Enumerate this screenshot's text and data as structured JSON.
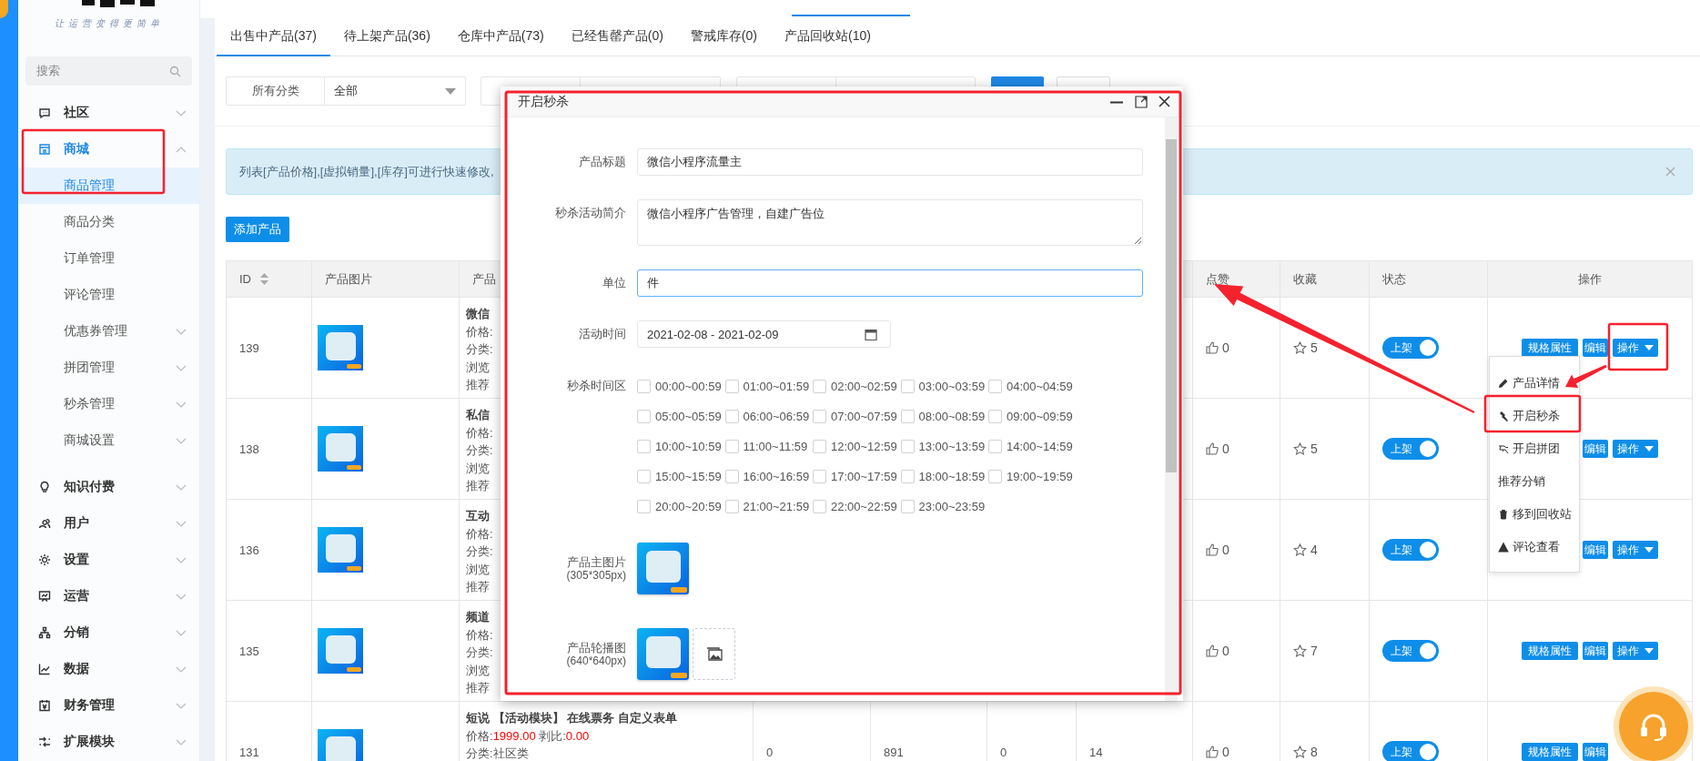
{
  "sidebar": {
    "slogan": "让运营变得更简单",
    "search": {
      "placeholder": "搜索"
    },
    "items": [
      {
        "label": "社区",
        "selected": false,
        "expanded": false
      },
      {
        "label": "商城",
        "selected": true,
        "expanded": true,
        "children": [
          {
            "label": "商品管理",
            "selected": true
          },
          {
            "label": "商品分类",
            "selected": false
          },
          {
            "label": "订单管理",
            "selected": false
          },
          {
            "label": "评论管理",
            "selected": false
          },
          {
            "label": "优惠券管理",
            "selected": false,
            "expanded": false
          },
          {
            "label": "拼团管理",
            "selected": false,
            "expanded": false
          },
          {
            "label": "秒杀管理",
            "selected": false,
            "expanded": false
          },
          {
            "label": "商城设置",
            "selected": false,
            "expanded": false
          }
        ]
      },
      {
        "label": "知识付费",
        "selected": false,
        "expanded": false
      },
      {
        "label": "用户",
        "selected": false,
        "expanded": false
      },
      {
        "label": "设置",
        "selected": false,
        "expanded": false
      },
      {
        "label": "运营",
        "selected": false,
        "expanded": false
      },
      {
        "label": "分销",
        "selected": false,
        "expanded": false
      },
      {
        "label": "数据",
        "selected": false,
        "expanded": false
      },
      {
        "label": "财务管理",
        "selected": false,
        "expanded": false
      },
      {
        "label": "扩展模块",
        "selected": false,
        "expanded": false
      }
    ]
  },
  "tabs": [
    {
      "label": "出售中产品(37)",
      "selected": true
    },
    {
      "label": "待上架产品(36)",
      "selected": false
    },
    {
      "label": "仓库中产品(73)",
      "selected": false
    },
    {
      "label": "已经售罄产品(0)",
      "selected": false
    },
    {
      "label": "警戒库存(0)",
      "selected": false
    },
    {
      "label": "产品回收站(10)",
      "selected": false
    }
  ],
  "filter": {
    "label": "所有分类",
    "value": "全部"
  },
  "alert": {
    "text": "列表[产品价格],[虚拟销量],[库存]可进行快速修改,"
  },
  "add_button": "添加产品",
  "table": {
    "columns": [
      {
        "label": "ID",
        "sortable": true
      },
      {
        "label": "产品图片"
      },
      {
        "label": "产品"
      },
      {},
      {},
      {},
      {},
      {
        "label": "点赞"
      },
      {
        "label": "收藏"
      },
      {
        "label": "状态"
      },
      {
        "label": "操作"
      }
    ],
    "rows": [
      {
        "id": "139",
        "name": "微信",
        "lines": [
          {
            "kind": "text",
            "text": "价格:"
          },
          {
            "kind": "text",
            "text": "分类:"
          },
          {
            "kind": "text",
            "text": "浏览"
          },
          {
            "kind": "text",
            "text": "推荐"
          }
        ],
        "likes": "0",
        "favorites": "5",
        "status": {
          "label": "上架",
          "on": true
        },
        "actions": [
          {
            "kind": "spec",
            "label": "规格属性"
          },
          {
            "kind": "edit",
            "label": "编辑"
          },
          {
            "kind": "more",
            "label": "操作"
          }
        ]
      },
      {
        "id": "138",
        "name": "私信",
        "lines": [
          {
            "kind": "text",
            "text": "价格:"
          },
          {
            "kind": "text",
            "text": "分类:"
          },
          {
            "kind": "text",
            "text": "浏览"
          },
          {
            "kind": "text",
            "text": "推荐"
          }
        ],
        "likes": "0",
        "favorites": "5",
        "status": {
          "label": "上架",
          "on": true
        },
        "actions": [
          {
            "kind": "edit",
            "label": "编辑"
          },
          {
            "kind": "more",
            "label": "操作"
          }
        ]
      },
      {
        "id": "136",
        "name": "互动",
        "lines": [
          {
            "kind": "text",
            "text": "价格:"
          },
          {
            "kind": "text",
            "text": "分类:"
          },
          {
            "kind": "text",
            "text": "浏览"
          },
          {
            "kind": "text",
            "text": "推荐"
          }
        ],
        "likes": "0",
        "favorites": "4",
        "status": {
          "label": "上架",
          "on": true
        },
        "actions": [
          {
            "kind": "edit",
            "label": "编辑"
          },
          {
            "kind": "more",
            "label": "操作"
          }
        ]
      },
      {
        "id": "135",
        "name": "频道",
        "lines": [
          {
            "kind": "text",
            "text": "价格:"
          },
          {
            "kind": "text",
            "text": "分类:"
          },
          {
            "kind": "text",
            "text": "浏览"
          },
          {
            "kind": "text",
            "text": "推荐"
          }
        ],
        "likes": "0",
        "favorites": "7",
        "status": {
          "label": "上架",
          "on": true
        },
        "actions": [
          {
            "kind": "spec",
            "label": "规格属性"
          },
          {
            "kind": "edit",
            "label": "编辑"
          },
          {
            "kind": "more",
            "label": "操作"
          }
        ]
      },
      {
        "id": "131",
        "name": "短说 【活动模块】 在线票务 自定义表单",
        "lines": [
          {
            "kind": "price",
            "label": "价格:",
            "value": "1999.00",
            "ratio_label": "剥比:",
            "ratio": "0.00"
          },
          {
            "kind": "text",
            "text": "分类:社区类"
          }
        ],
        "stats": [
          "0",
          "891",
          "0",
          "14"
        ],
        "likes": "0",
        "favorites": "8",
        "status": {
          "label": "上架",
          "on": true
        },
        "actions": [
          {
            "kind": "spec",
            "label": "规格属性"
          },
          {
            "kind": "edit",
            "label": "编辑"
          }
        ]
      }
    ]
  },
  "dropdown": {
    "items": [
      {
        "label": "产品详情"
      },
      {
        "label": "开启秒杀"
      },
      {
        "label": "开启拼团"
      },
      {
        "label": "推荐分销"
      },
      {
        "label": "移到回收站"
      },
      {
        "label": "评论查看"
      }
    ]
  },
  "modal": {
    "title": "开启秒杀",
    "fields": [
      {
        "kind": "input",
        "label": "产品标题",
        "value": "微信小程序流量主",
        "focused": false
      },
      {
        "kind": "textarea",
        "label": "秒杀活动简介",
        "value": "微信小程序广告管理，自建广告位",
        "focused": false
      },
      {
        "kind": "input",
        "label": "单位",
        "value": "件",
        "focused": true
      },
      {
        "kind": "date",
        "label": "活动时间",
        "value": "2021-02-08 - 2021-02-09",
        "focused": false
      },
      {
        "kind": "checkboxes",
        "label": "秒杀时间区",
        "options": [
          {
            "label": "00:00~00:59",
            "checked": false
          },
          {
            "label": "01:00~01:59",
            "checked": false
          },
          {
            "label": "02:00~02:59",
            "checked": false
          },
          {
            "label": "03:00~03:59",
            "checked": false
          },
          {
            "label": "04:00~04:59",
            "checked": false
          },
          {
            "label": "05:00~05:59",
            "checked": false
          },
          {
            "label": "06:00~06:59",
            "checked": false
          },
          {
            "label": "07:00~07:59",
            "checked": false
          },
          {
            "label": "08:00~08:59",
            "checked": false
          },
          {
            "label": "09:00~09:59",
            "checked": false
          },
          {
            "label": "10:00~10:59",
            "checked": false
          },
          {
            "label": "11:00~11:59",
            "checked": false
          },
          {
            "label": "12:00~12:59",
            "checked": false
          },
          {
            "label": "13:00~13:59",
            "checked": false
          },
          {
            "label": "14:00~14:59",
            "checked": false
          },
          {
            "label": "15:00~15:59",
            "checked": false
          },
          {
            "label": "16:00~16:59",
            "checked": false
          },
          {
            "label": "17:00~17:59",
            "checked": false
          },
          {
            "label": "18:00~18:59",
            "checked": false
          },
          {
            "label": "19:00~19:59",
            "checked": false
          },
          {
            "label": "20:00~20:59",
            "checked": false
          },
          {
            "label": "21:00~21:59",
            "checked": false
          },
          {
            "label": "22:00~22:59",
            "checked": false
          },
          {
            "label": "23:00~23:59",
            "checked": false
          }
        ]
      },
      {
        "kind": "image",
        "label": "产品主图片",
        "hint": "(305*305px)"
      },
      {
        "kind": "gallery",
        "label": "产品轮播图",
        "hint": "(640*640px)"
      }
    ]
  }
}
